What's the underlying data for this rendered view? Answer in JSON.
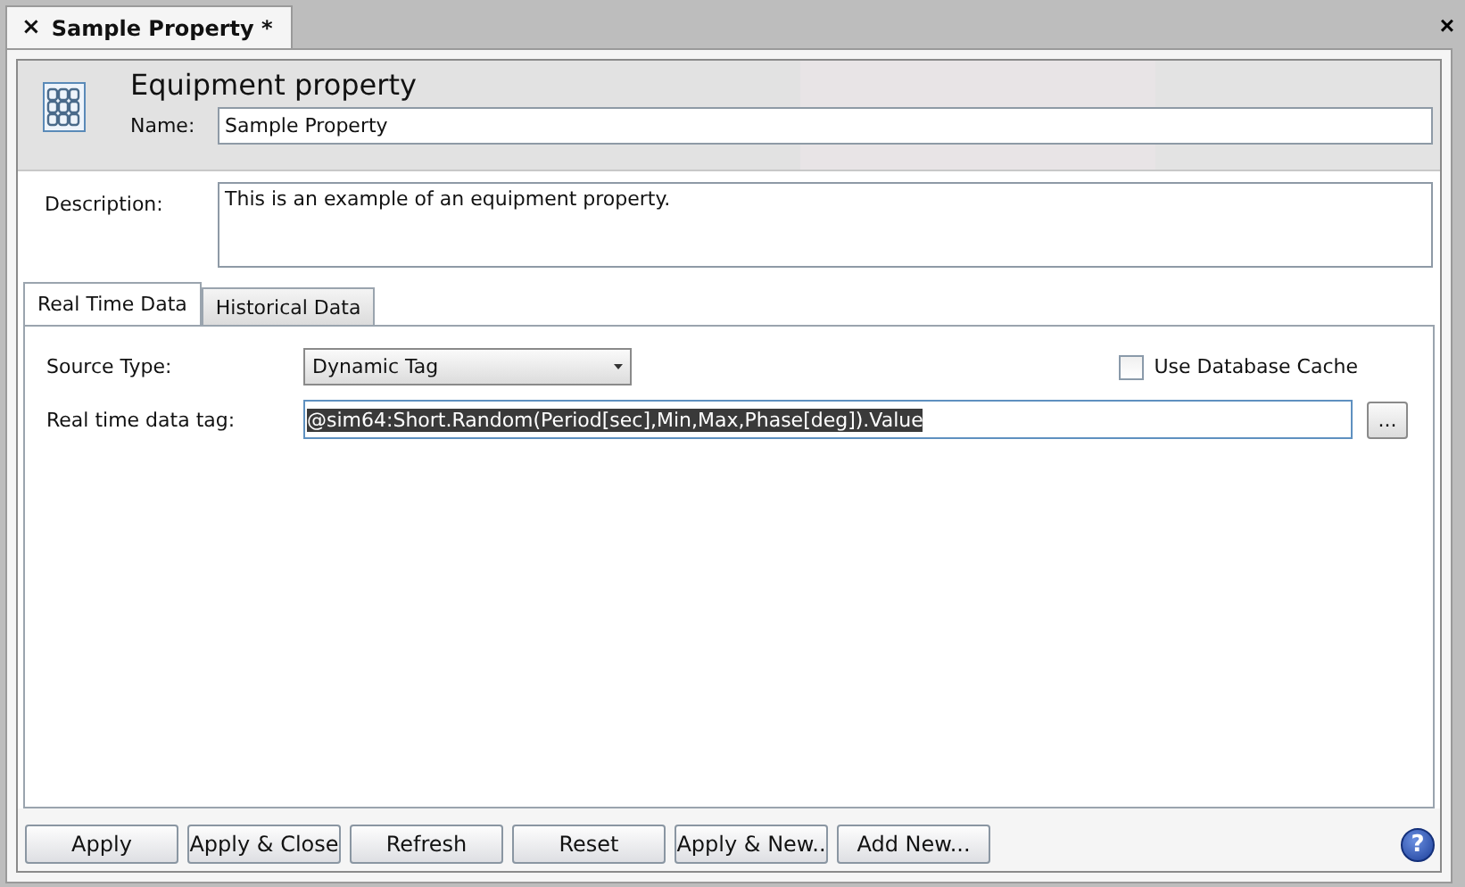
{
  "document_tab": {
    "close": "×",
    "title": "Sample Property *",
    "selected": true
  },
  "window_close": "×",
  "header": {
    "title": "Equipment property",
    "name_label": "Name:",
    "name_value": "Sample Property"
  },
  "description": {
    "label": "Description:",
    "value": "This is an example of an equipment property."
  },
  "tabs": [
    {
      "label": "Real Time Data",
      "selected": true
    },
    {
      "label": "Historical Data",
      "selected": false
    }
  ],
  "source_type": {
    "label": "Source Type:",
    "value": "Dynamic Tag"
  },
  "use_database_cache": {
    "label": "Use Database Cache",
    "checked": false
  },
  "data_tag": {
    "label": "Real time data tag:",
    "value": "@sim64:Short.Random(Period[sec],Min,Max,Phase[deg]).Value",
    "selected": true,
    "browse": "..."
  },
  "buttons": [
    "Apply",
    "Apply & Close",
    "Refresh",
    "Reset",
    "Apply & New..",
    "Add New..."
  ],
  "help": "?"
}
